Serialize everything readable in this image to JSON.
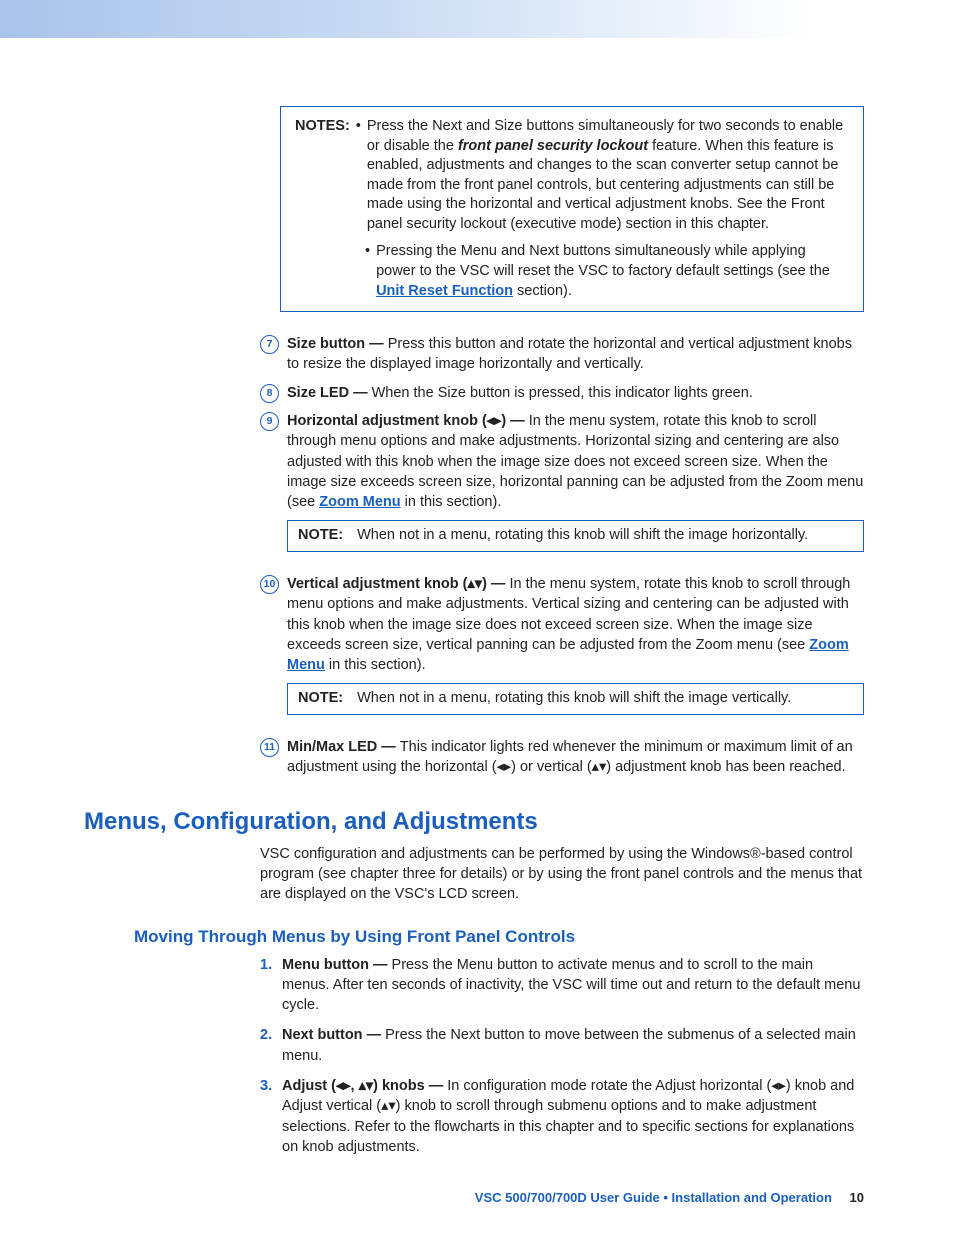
{
  "notesBox": {
    "label": "NOTES:",
    "b1_pre": "Press the Next and Size buttons simultaneously for two seconds to enable or disable the ",
    "b1_emph": "front panel security lockout",
    "b1_post": " feature. When this feature is enabled, adjustments and changes to the scan converter setup cannot be made from the front panel controls, but centering adjustments can still be made using the horizontal and vertical adjustment knobs. See the Front panel security lockout (executive mode) section in this chapter.",
    "b2_pre": "Pressing the Menu and Next buttons simultaneously while applying power to the VSC will reset the VSC to factory default settings (see the ",
    "b2_link": "Unit Reset Function",
    "b2_post": " section)."
  },
  "items": {
    "i7": {
      "num": "7",
      "term": "Size button — ",
      "body": "Press this button and rotate the horizontal and vertical adjustment knobs to resize the displayed image horizontally and vertically."
    },
    "i8": {
      "num": "8",
      "term": "Size LED — ",
      "body": "When the Size button is pressed, this indicator lights green."
    },
    "i9": {
      "num": "9",
      "term": "Horizontal adjustment knob (◂▸) — ",
      "body_pre": "In the menu system, rotate this knob to scroll through menu options and make adjustments. Horizontal sizing and centering are also adjusted with this knob when the image size does not exceed screen size. When the image size exceeds screen size, horizontal panning can be adjusted from the Zoom menu (see ",
      "link": "Zoom Menu",
      "body_post": " in this section).",
      "note_label": "NOTE:",
      "note": "When not in a menu, rotating this knob will shift the image horizontally."
    },
    "i10": {
      "num": "10",
      "term": "Vertical adjustment knob (",
      "term_glyph": "▴▾",
      "term_post": ") — ",
      "body_pre": "In the menu system, rotate this knob to scroll through menu options and make adjustments. Vertical sizing and centering can be adjusted with this knob when the image size does not exceed screen size.  When the image size exceeds screen size, vertical panning can be adjusted from the Zoom menu (see ",
      "link": "Zoom Menu",
      "body_post": " in this section).",
      "note_label": "NOTE:",
      "note": "When not in a menu, rotating this knob will shift the image vertically."
    },
    "i11": {
      "num": "11",
      "term": "Min/Max LED — ",
      "body": "This indicator lights red whenever the minimum or maximum limit of an adjustment using the horizontal (◂▸) or vertical (▴▾) adjustment knob has been reached."
    }
  },
  "h1": "Menus, Configuration, and Adjustments",
  "intro": "VSC configuration and adjustments can be performed by using the Windows®-based control program (see chapter three for details) or by using the front panel controls and the menus that are displayed on the VSC's LCD screen.",
  "h2": "Moving Through Menus by Using Front Panel Controls",
  "ol": {
    "n1": {
      "num": "1.",
      "term": "Menu button — ",
      "body": "Press the Menu button to activate menus and to scroll to the main menus. After ten seconds of inactivity, the VSC will time out and return to the default menu cycle."
    },
    "n2": {
      "num": "2.",
      "term": "Next button — ",
      "body": "Press the Next button to move between the submenus of a selected main menu."
    },
    "n3": {
      "num": "3.",
      "term_pre": "Adjust ",
      "term_glyph": "(◂▸, ▴▾)",
      "term_post": " knobs — ",
      "body": "In configuration mode rotate the Adjust horizontal (◂▸) knob and Adjust vertical (▴▾) knob to scroll through submenu options and to make adjustment selections. Refer to the flowcharts in this chapter and to specific sections for explanations on knob adjustments."
    }
  },
  "footer": {
    "title": "VSC 500/700/700D User Guide • Installation and Operation",
    "page": "10"
  }
}
